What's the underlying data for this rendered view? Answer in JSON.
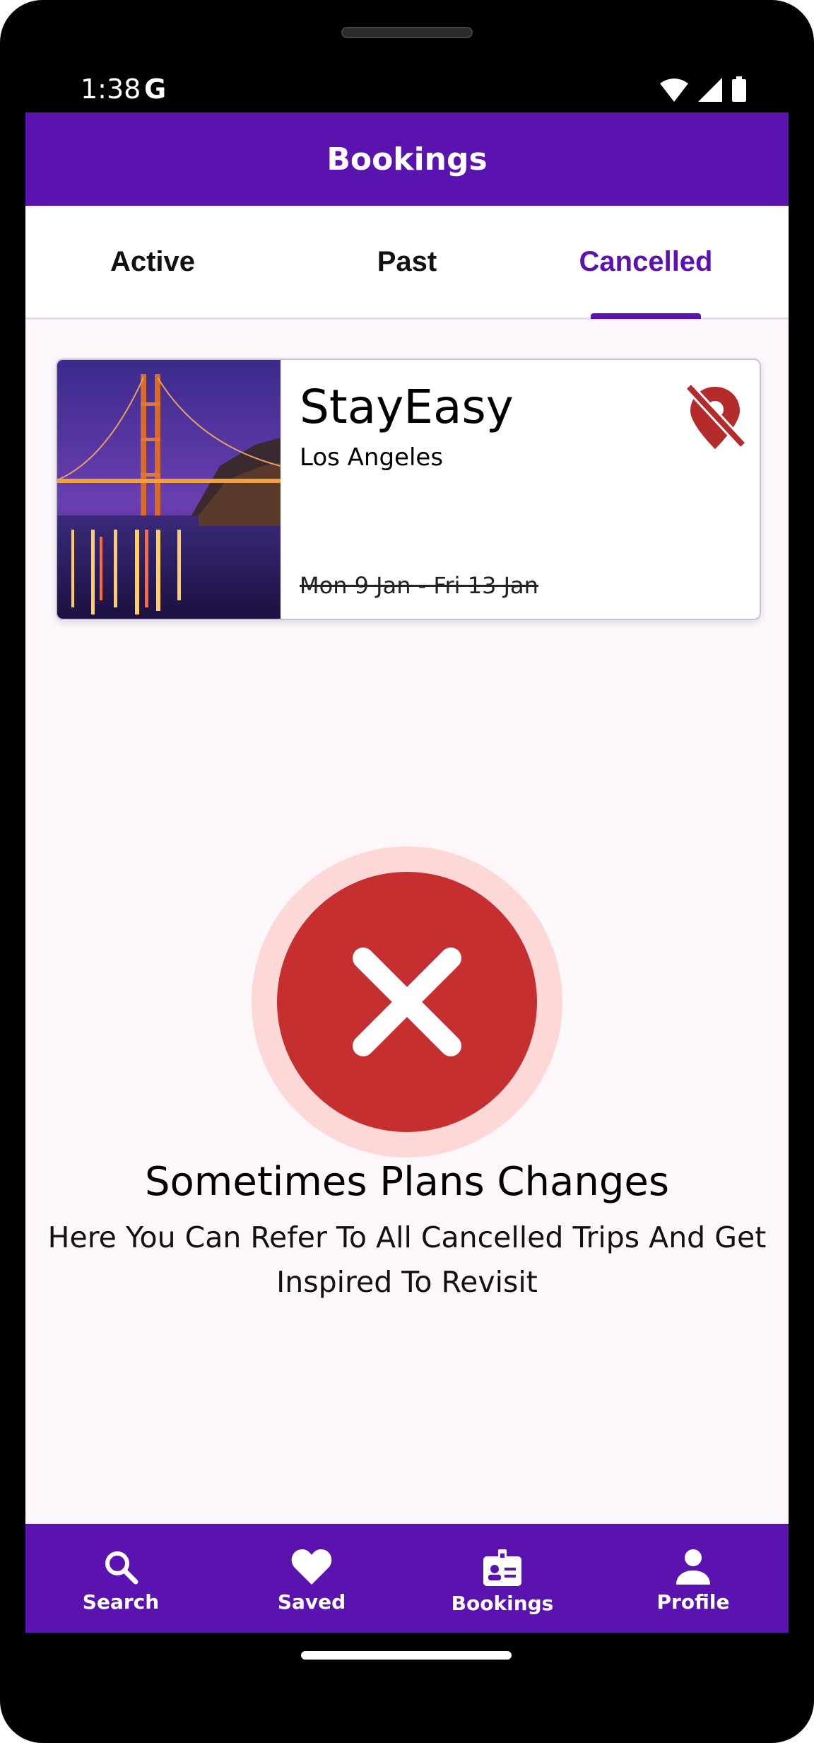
{
  "status_bar": {
    "time": "1:38",
    "g_label": "G"
  },
  "app_bar": {
    "title": "Bookings"
  },
  "tabs": [
    {
      "label": "Active"
    },
    {
      "label": "Past"
    },
    {
      "label": "Cancelled"
    }
  ],
  "active_tab": "Cancelled",
  "booking": {
    "name": "StayEasy",
    "city": "Los Angeles",
    "dates": "Mon 9 Jan - Fri 13 Jan",
    "image": "golden-gate-bridge-night",
    "status_icon": "location-off-icon"
  },
  "empty_state": {
    "icon": "cancel-x-icon",
    "title": "Sometimes Plans Changes",
    "subtitle": "Here You Can Refer To All Cancelled Trips And Get Inspired To Revisit"
  },
  "bottom_nav": [
    {
      "label": "Search",
      "icon": "search-icon"
    },
    {
      "label": "Saved",
      "icon": "heart-icon"
    },
    {
      "label": "Bookings",
      "icon": "badge-icon"
    },
    {
      "label": "Profile",
      "icon": "person-icon"
    }
  ],
  "colors": {
    "primary": "#5b13af",
    "cancel_red": "#c62f30",
    "cancel_ring": "#fcd8d6",
    "background": "#fdf7fc"
  }
}
